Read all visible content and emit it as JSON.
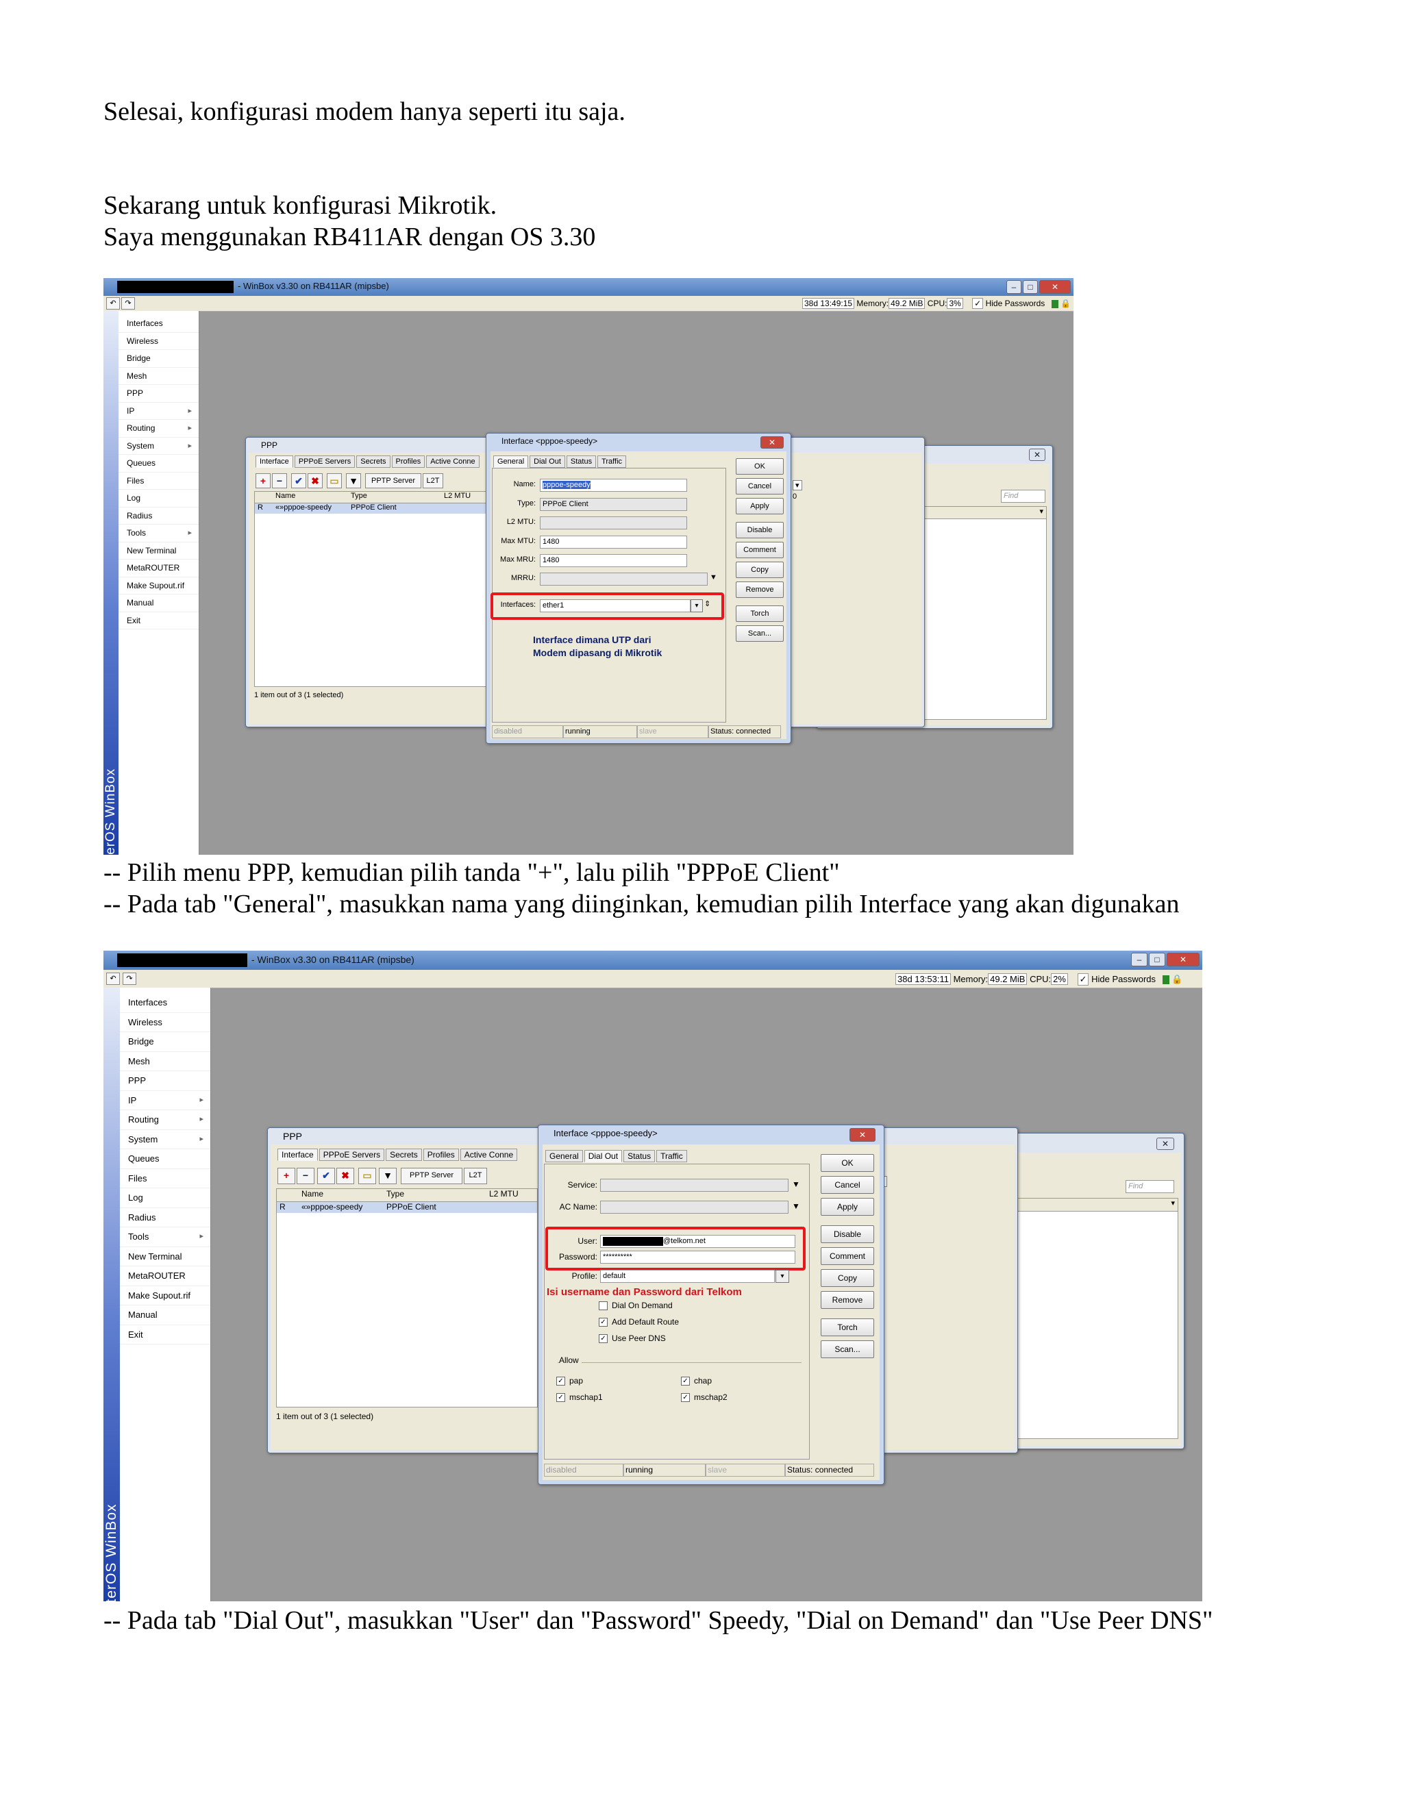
{
  "paragraphs": {
    "p1": "Selesai, konfigurasi modem hanya seperti itu saja.",
    "p2": "Sekarang untuk konfigurasi Mikrotik.",
    "p3": "Saya menggunakan RB411AR dengan OS 3.30",
    "cap1": "-- Pilih menu PPP, kemudian pilih tanda \"+\", lalu pilih \"PPPoE Client\"",
    "cap2": "-- Pada tab \"General\", masukkan nama yang diinginkan, kemudian pilih Interface yang akan digunakan",
    "cap3": "-- Pada tab \"Dial Out\", masukkan \"User\" dan \"Password\" Speedy, \"Dial on Demand\" dan \"Use Peer DNS\""
  },
  "shot1": {
    "window_title": "- WinBox v3.30 on RB411AR (mipsbe)",
    "uptime": "38d 13:49:15",
    "memory_label": "Memory:",
    "memory": "49.2 MiB",
    "cpu_label": "CPU:",
    "cpu": "3%",
    "hide_passwords": "Hide Passwords",
    "brand": "RouterOS WinBox",
    "menu": [
      "Interfaces",
      "Wireless",
      "Bridge",
      "Mesh",
      "PPP",
      "IP",
      "Routing",
      "System",
      "Queues",
      "Files",
      "Log",
      "Radius",
      "Tools",
      "New Terminal",
      "MetaROUTER",
      "Make Supout.rif",
      "Manual",
      "Exit"
    ],
    "ppp_title": "PPP",
    "ppp_tabs": [
      "Interface",
      "PPPoE Servers",
      "Secrets",
      "Profiles",
      "Active Conne"
    ],
    "pptp_server": "PPTP Server",
    "l2_trunc": "L2T",
    "col_name": "Name",
    "col_type": "Type",
    "col_l2mtu": "L2 MTU",
    "row_flag": "R",
    "row_name": "«»pppoe-speedy",
    "row_type": "PPPoE Client",
    "ppp_footer": "1 item out of 3 (1 selected)",
    "find": "Find",
    "right_val": "0",
    "dlg_title": "Interface <pppoe-speedy>",
    "dlg_tabs": [
      "General",
      "Dial Out",
      "Status",
      "Traffic"
    ],
    "lbl_name": "Name:",
    "val_name": "pppoe-speedy",
    "lbl_type": "Type:",
    "val_type": "PPPoE Client",
    "lbl_l2mtu": "L2 MTU:",
    "lbl_maxmtu": "Max MTU:",
    "val_maxmtu": "1480",
    "lbl_maxmru": "Max MRU:",
    "val_maxmru": "1480",
    "lbl_mrru": "MRRU:",
    "lbl_interfaces": "Interfaces:",
    "val_interfaces": "ether1",
    "annot_1": "Interface dimana UTP dari",
    "annot_2": "Modem dipasang di Mikrotik",
    "buttons": [
      "OK",
      "Cancel",
      "Apply",
      "Disable",
      "Comment",
      "Copy",
      "Remove",
      "Torch",
      "Scan..."
    ],
    "st_disabled": "disabled",
    "st_running": "running",
    "st_slave": "slave",
    "st_status": "Status: connected"
  },
  "shot2": {
    "window_title": "- WinBox v3.30 on RB411AR (mipsbe)",
    "uptime": "38d 13:53:11",
    "memory_label": "Memory:",
    "memory": "49.2 MiB",
    "cpu_label": "CPU:",
    "cpu": "2%",
    "hide_passwords": "Hide Passwords",
    "brand": "RouterOS WinBox",
    "menu": [
      "Interfaces",
      "Wireless",
      "Bridge",
      "Mesh",
      "PPP",
      "IP",
      "Routing",
      "System",
      "Queues",
      "Files",
      "Log",
      "Radius",
      "Tools",
      "New Terminal",
      "MetaROUTER",
      "Make Supout.rif",
      "Manual",
      "Exit"
    ],
    "ppp_title": "PPP",
    "ppp_tabs": [
      "Interface",
      "PPPoE Servers",
      "Secrets",
      "Profiles",
      "Active Conne"
    ],
    "pptp_server": "PPTP Server",
    "l2_trunc": "L2T",
    "col_name": "Name",
    "col_type": "Type",
    "col_l2mtu": "L2 MTU",
    "row_flag": "R",
    "row_name": "«»pppoe-speedy",
    "row_type": "PPPoE Client",
    "ppp_footer": "1 item out of 3 (1 selected)",
    "find": "Find",
    "right_val": "0",
    "dlg_title": "Interface <pppoe-speedy>",
    "dlg_tabs": [
      "General",
      "Dial Out",
      "Status",
      "Traffic"
    ],
    "lbl_service": "Service:",
    "lbl_acname": "AC Name:",
    "lbl_user": "User:",
    "val_user_suffix": "@telkom.net",
    "lbl_password": "Password:",
    "val_password": "**********",
    "lbl_profile": "Profile:",
    "val_profile": "default",
    "annot": "Isi username dan Password dari Telkom",
    "chk_dial_on_demand": "Dial On Demand",
    "chk_default_route": "Add Default Route",
    "chk_peer_dns": "Use Peer DNS",
    "allow": "Allow",
    "pap": "pap",
    "chap": "chap",
    "mschap1": "mschap1",
    "mschap2": "mschap2",
    "buttons": [
      "OK",
      "Cancel",
      "Apply",
      "Disable",
      "Comment",
      "Copy",
      "Remove",
      "Torch",
      "Scan..."
    ],
    "st_disabled": "disabled",
    "st_running": "running",
    "st_slave": "slave",
    "st_status": "Status: connected"
  },
  "colors": {
    "redbox": "#e8171c",
    "annot_red": "#d4141b",
    "annot_blue": "#0b1f6b",
    "titlebar": "#4f7fc0"
  },
  "icons": [
    "undo-icon",
    "redo-icon",
    "close-icon",
    "add-icon",
    "remove-icon",
    "check-icon",
    "x-icon",
    "comment-icon",
    "filter-icon",
    "lock-icon",
    "dropdown-icon"
  ]
}
